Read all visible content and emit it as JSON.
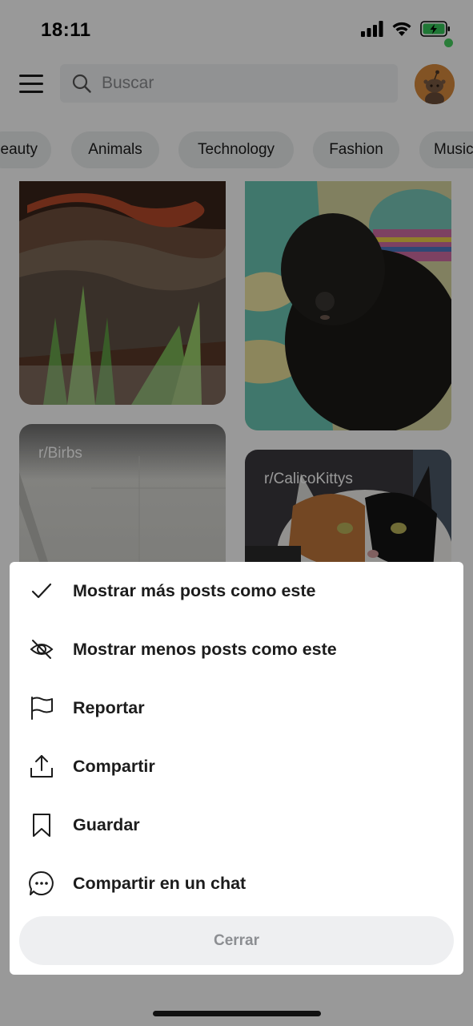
{
  "status_bar": {
    "time": "18:11"
  },
  "search": {
    "placeholder": "Buscar"
  },
  "chips": [
    "eauty",
    "Animals",
    "Technology",
    "Fashion",
    "Music"
  ],
  "feed": {
    "cards": [
      {
        "subreddit": ""
      },
      {
        "subreddit": ""
      },
      {
        "subreddit": "r/Birbs"
      },
      {
        "subreddit": "r/CalicoKittys"
      }
    ]
  },
  "sheet": {
    "items": [
      {
        "icon": "checkmark-icon",
        "label": "Mostrar más posts como este"
      },
      {
        "icon": "eye-off-icon",
        "label": "Mostrar menos posts como este"
      },
      {
        "icon": "flag-icon",
        "label": "Reportar"
      },
      {
        "icon": "share-icon",
        "label": "Compartir"
      },
      {
        "icon": "bookmark-icon",
        "label": "Guardar"
      },
      {
        "icon": "chat-bubble-icon",
        "label": "Compartir en un chat"
      }
    ],
    "close_label": "Cerrar"
  },
  "colors": {
    "online": "#46d160",
    "battery": "#34c759",
    "scrim": "rgba(0,0,0,0.40)"
  }
}
